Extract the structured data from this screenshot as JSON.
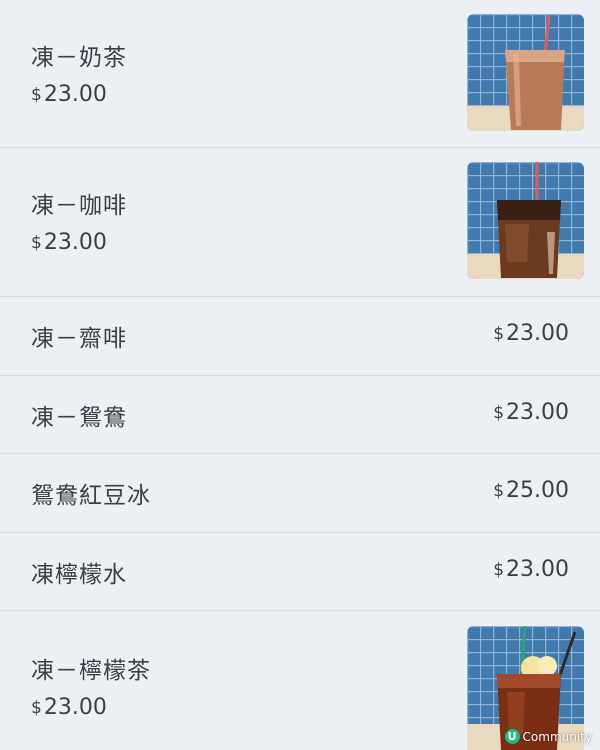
{
  "menu": {
    "items": [
      {
        "name": "凍－奶茶",
        "currency": "$",
        "price": "23.00",
        "image": "iced-milk-tea-photo"
      },
      {
        "name": "凍－咖啡",
        "currency": "$",
        "price": "23.00",
        "image": "iced-coffee-photo"
      },
      {
        "name": "凍－齋啡",
        "currency": "$",
        "price": "23.00"
      },
      {
        "name": "凍－鴛鴦",
        "currency": "$",
        "price": "23.00"
      },
      {
        "name": "鴛鴦紅豆冰",
        "currency": "$",
        "price": "25.00"
      },
      {
        "name": "凍檸檬水",
        "currency": "$",
        "price": "23.00"
      },
      {
        "name": "凍－檸檬茶",
        "currency": "$",
        "price": "23.00",
        "image": "iced-lemon-tea-photo"
      }
    ]
  },
  "watermark": {
    "logo_letter": "U",
    "text": "Community"
  },
  "colors": {
    "background": "#ecf0f4",
    "divider": "#d9dee4",
    "text": "#3a3f46",
    "tile_blue": "#3d74a6",
    "logo_green": "#1ebc7e"
  }
}
